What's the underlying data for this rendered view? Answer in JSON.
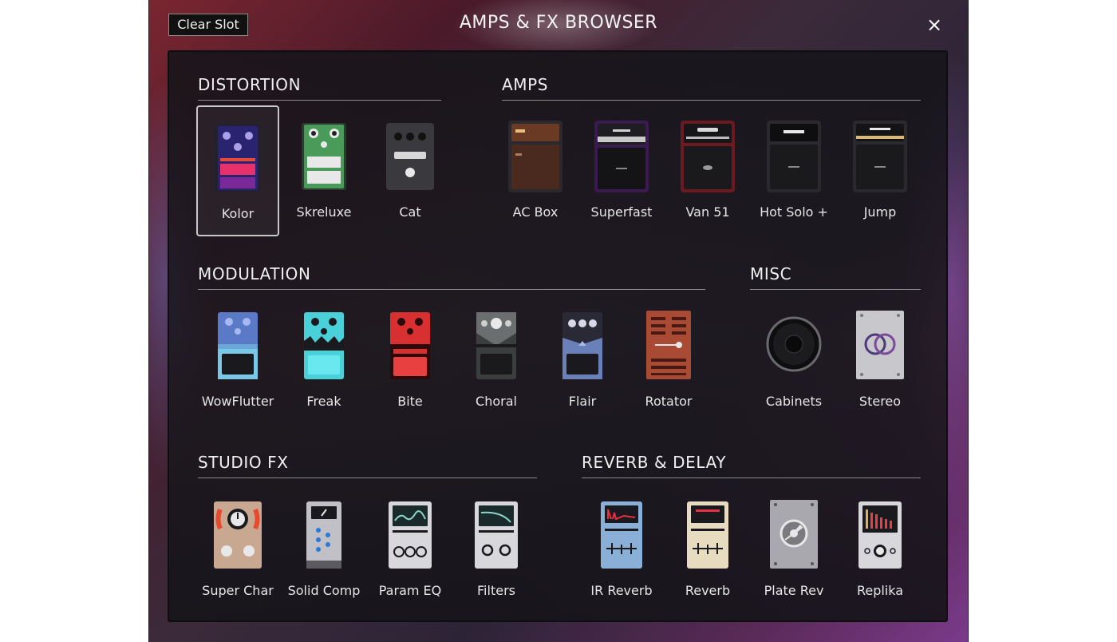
{
  "window": {
    "title": "AMPS & FX BROWSER",
    "clear_slot": "Clear Slot",
    "close": "×"
  },
  "sections": {
    "distortion": {
      "title": "DISTORTION",
      "items": [
        "Kolor",
        "Skreluxe",
        "Cat"
      ],
      "selected": "Kolor"
    },
    "amps": {
      "title": "AMPS",
      "items": [
        "AC Box",
        "Superfast",
        "Van 51",
        "Hot Solo +",
        "Jump"
      ]
    },
    "modulation": {
      "title": "MODULATION",
      "items": [
        "WowFlutter",
        "Freak",
        "Bite",
        "Choral",
        "Flair",
        "Rotator"
      ]
    },
    "misc": {
      "title": "MISC",
      "items": [
        "Cabinets",
        "Stereo"
      ]
    },
    "studio_fx": {
      "title": "STUDIO FX",
      "items": [
        "Super Char",
        "Solid Comp",
        "Param EQ",
        "Filters"
      ]
    },
    "reverb_delay": {
      "title": "REVERB & DELAY",
      "items": [
        "IR Reverb",
        "Reverb",
        "Plate Rev",
        "Replika"
      ]
    }
  }
}
